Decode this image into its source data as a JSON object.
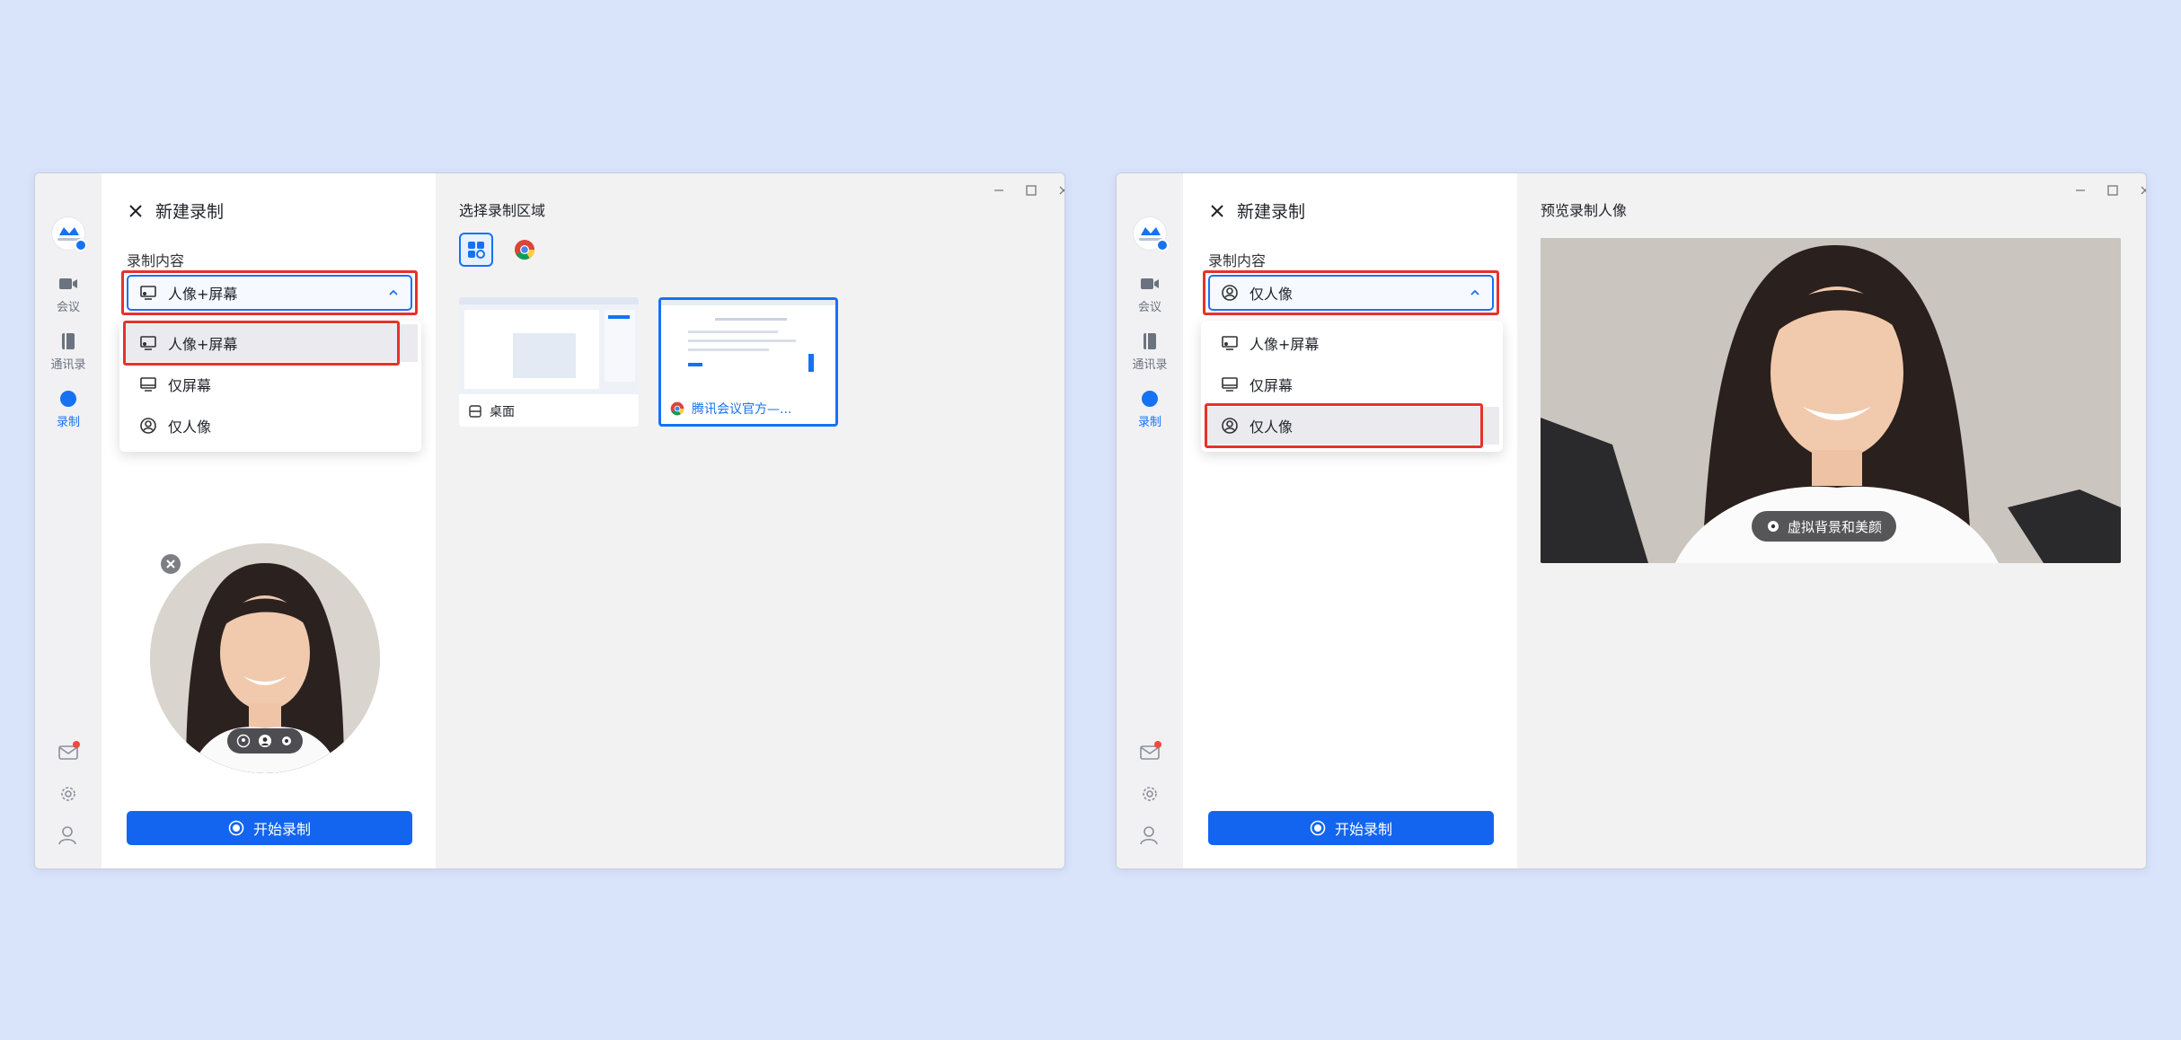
{
  "colors": {
    "accent": "#1672f3",
    "highlight_outline": "#e8312b",
    "page_bg": "#d9e4fb"
  },
  "rail": {
    "meeting_label": "会议",
    "contacts_label": "通讯录",
    "record_label": "录制",
    "bottom_icons": [
      "mail-icon",
      "gear-icon",
      "user-settings-icon"
    ]
  },
  "left_window": {
    "panel_title": "新建录制",
    "content_label": "录制内容",
    "selected_value": "人像+屏幕",
    "options": [
      "人像+屏幕",
      "仅屏幕",
      "仅人像"
    ],
    "selected_option_index": 0,
    "start_button": "开始录制",
    "area_title": "选择录制区域",
    "source_tabs": [
      "apps-grid-icon",
      "chrome-icon"
    ],
    "thumbnails": [
      {
        "caption": "桌面",
        "icon": "window-icon",
        "selected": false
      },
      {
        "caption": "腾讯会议官方—...",
        "icon": "chrome-icon",
        "selected": true
      }
    ],
    "avatar_controls": [
      "portrait-icon",
      "user-icon",
      "gear-icon"
    ]
  },
  "right_window": {
    "panel_title": "新建录制",
    "content_label": "录制内容",
    "selected_value": "仅人像",
    "options": [
      "人像+屏幕",
      "仅屏幕",
      "仅人像"
    ],
    "selected_option_index": 2,
    "start_button": "开始录制",
    "preview_title": "预览录制人像",
    "virtual_bg_button": "虚拟背景和美颜"
  }
}
